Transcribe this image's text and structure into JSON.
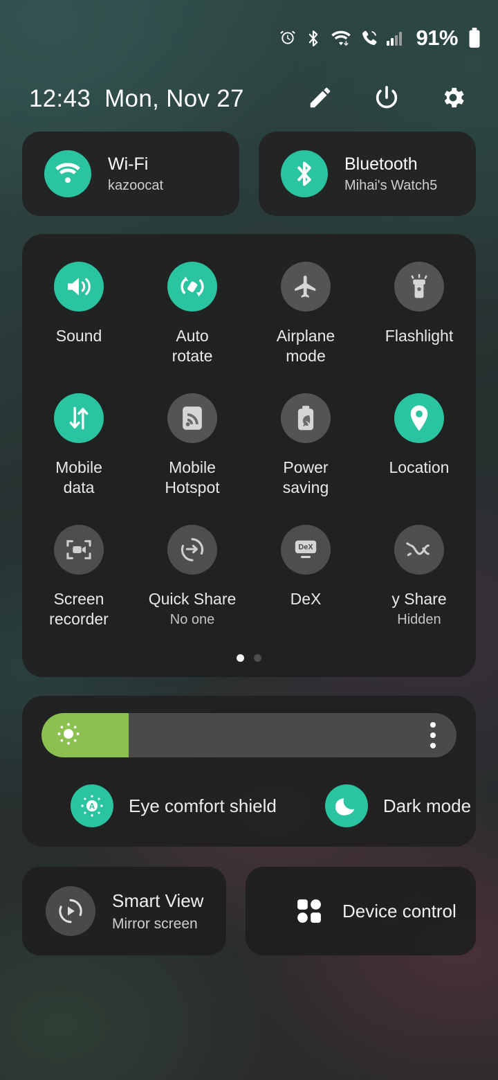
{
  "statusbar": {
    "icons": [
      "alarm-icon",
      "bluetooth-icon",
      "wifi-icon",
      "call-icon",
      "signal-icon"
    ],
    "battery_percent": "91%"
  },
  "header": {
    "time": "12:43",
    "date": "Mon, Nov 27",
    "actions": [
      {
        "name": "edit-button",
        "icon": "pencil-icon"
      },
      {
        "name": "power-button",
        "icon": "power-icon"
      },
      {
        "name": "settings-button",
        "icon": "gear-icon"
      }
    ]
  },
  "connections": [
    {
      "name": "wifi-card",
      "icon": "wifi-icon",
      "title": "Wi-Fi",
      "subtitle": "kazoocat",
      "state": "on"
    },
    {
      "name": "bluetooth-card",
      "icon": "bluetooth-icon",
      "title": "Bluetooth",
      "subtitle": "Mihai's Watch5",
      "state": "on"
    }
  ],
  "quick_settings": {
    "tiles": [
      {
        "name": "tile-sound",
        "icon": "volume-icon",
        "label": "Sound",
        "sub": "",
        "state": "on"
      },
      {
        "name": "tile-auto-rotate",
        "icon": "auto-rotate-icon",
        "label": "Auto\nrotate",
        "sub": "",
        "state": "on"
      },
      {
        "name": "tile-airplane-mode",
        "icon": "airplane-icon",
        "label": "Airplane\nmode",
        "sub": "",
        "state": "off"
      },
      {
        "name": "tile-flashlight",
        "icon": "flashlight-icon",
        "label": "Flashlight",
        "sub": "",
        "state": "off"
      },
      {
        "name": "tile-mobile-data",
        "icon": "data-arrows-icon",
        "label": "Mobile\ndata",
        "sub": "",
        "state": "on"
      },
      {
        "name": "tile-mobile-hotspot",
        "icon": "hotspot-icon",
        "label": "Mobile\nHotspot",
        "sub": "",
        "state": "off"
      },
      {
        "name": "tile-power-saving",
        "icon": "battery-leaf-icon",
        "label": "Power\nsaving",
        "sub": "",
        "state": "off"
      },
      {
        "name": "tile-location",
        "icon": "location-pin-icon",
        "label": "Location",
        "sub": "",
        "state": "on"
      },
      {
        "name": "tile-screen-recorder",
        "icon": "screen-recorder-icon",
        "label": "Screen\nrecorder",
        "sub": "",
        "state": "off"
      },
      {
        "name": "tile-quick-share",
        "icon": "quick-share-icon",
        "label": "Quick Share",
        "sub": "No one",
        "state": "off"
      },
      {
        "name": "tile-dex",
        "icon": "dex-icon",
        "label": "DeX",
        "sub": "",
        "state": "off"
      },
      {
        "name": "tile-music-share",
        "icon": "music-share-icon",
        "label": "y Share",
        "sub": "Hidden",
        "state": "off"
      }
    ],
    "page_dots": {
      "count": 2,
      "active": 1
    }
  },
  "brightness": {
    "name": "brightness-slider",
    "icon": "brightness-sun-icon",
    "level_percent": 21,
    "fill_color": "#8cc152",
    "menu_icon": "more-options-icon"
  },
  "display_modes": [
    {
      "name": "eye-comfort-shield-toggle",
      "icon": "eye-comfort-icon",
      "label": "Eye comfort shield",
      "state": "on"
    },
    {
      "name": "dark-mode-toggle",
      "icon": "moon-icon",
      "label": "Dark mode",
      "state": "on"
    }
  ],
  "bottom_cards": [
    {
      "name": "smart-view-card",
      "icon": "smart-view-icon",
      "title": "Smart View",
      "subtitle": "Mirror screen"
    },
    {
      "name": "device-control-card",
      "icon": "device-control-icon",
      "title": "Device control",
      "subtitle": ""
    }
  ],
  "colors": {
    "accent_teal": "#2bc4a0",
    "slider_green": "#8cc152",
    "tile_off_gray": "#545454",
    "panel_bg": "#202020"
  }
}
